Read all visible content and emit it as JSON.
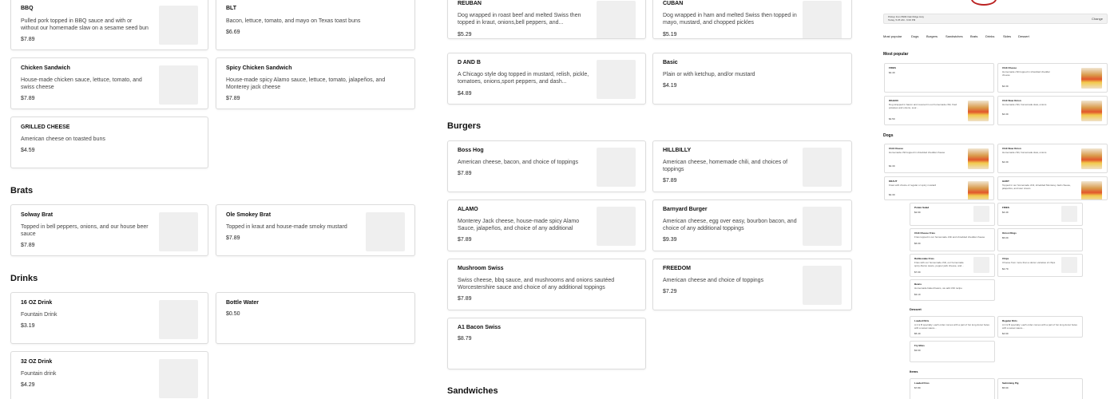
{
  "left": {
    "cards_top": [
      {
        "title": "BBQ",
        "desc": "Pulled pork topped in BBQ sauce and with or without our homemade slaw on a sesame seed bun",
        "price": "$7.89"
      },
      {
        "title": "BLT",
        "desc": "Bacon, lettuce, tomato, and mayo on Texas toast buns",
        "price": "$6.69"
      },
      {
        "title": "Chicken Sandwich",
        "desc": "House-made chicken sauce, lettuce, tomato, and swiss cheese",
        "price": "$7.89"
      },
      {
        "title": "Spicy Chicken Sandwich",
        "desc": "House-made spicy Alamo sauce, lettuce, tomato, jalapeños, and Monterey jack cheese",
        "price": "$7.89"
      },
      {
        "title": "GRILLED CHEESE",
        "desc": "American cheese on toasted buns",
        "price": "$4.59"
      }
    ],
    "brats_heading": "Brats",
    "brats": [
      {
        "title": "Solway Brat",
        "desc": "Topped in bell peppers, onions, and our house beer sauce",
        "price": "$7.89"
      },
      {
        "title": "Ole Smokey Brat",
        "desc": "Topped in kraut and house-made smoky mustard",
        "price": "$7.89"
      }
    ],
    "drinks_heading": "Drinks",
    "drinks": [
      {
        "title": "16 OZ Drink",
        "desc": "Fountain Drink",
        "price": "$3.19"
      },
      {
        "title": "Bottle Water",
        "desc": "",
        "price": "$0.50"
      },
      {
        "title": "32 OZ Drink",
        "desc": "Fountain drink",
        "price": "$4.29"
      }
    ]
  },
  "mid": {
    "cards_top": [
      {
        "title": "REUBAN",
        "desc": "Dog wrapped in roast beef and melted Swiss then topped in kraut, onions,bell peppers, and...",
        "price": "$5.29"
      },
      {
        "title": "CUBAN",
        "desc": "Dog wrapped in ham and melted Swiss then topped in mayo, mustard, and chopped pickles",
        "price": "$5.19"
      },
      {
        "title": "D AND B",
        "desc": "A Chicago style dog topped in mustard, relish, pickle, tomatoes, onions,sport peppers, and dash...",
        "price": "$4.89"
      },
      {
        "title": "Basic",
        "desc": "Plain or with ketchup, and/or mustard",
        "price": "$4.19"
      }
    ],
    "burgers_heading": "Burgers",
    "burgers": [
      {
        "title": "Boss Hog",
        "desc": "American cheese, bacon, and choice of toppings",
        "price": "$7.89"
      },
      {
        "title": "HILLBILLY",
        "desc": "American cheese, homemade chili, and choices of toppings",
        "price": "$7.89"
      },
      {
        "title": "ALAMO",
        "desc": "Monterey Jack cheese, house-made spicy Alamo Sauce, jalapeños, and choice of any additional toppings",
        "price": "$7.89"
      },
      {
        "title": "Barnyard Burger",
        "desc": "American cheese, egg over easy, bourbon bacon, and choice of any additional toppings",
        "price": "$9.39"
      },
      {
        "title": "Mushroom Swiss",
        "desc": "Swiss cheese, bbq sauce, and mushrooms and onions sautéed Worcestershire sauce and choice of any additional toppings",
        "price": "$7.89"
      },
      {
        "title": "FREEDOM",
        "desc": "American cheese and choice of toppings",
        "price": "$7.29"
      },
      {
        "title": "A1 Bacon Swiss",
        "desc": "",
        "price": "$8.79"
      }
    ],
    "sandwiches_heading": "Sandwiches"
  },
  "right": {
    "pickup_line1": "Pickup from 8909 Oak Ridge Hwy",
    "pickup_line2": "Today, 5:25 AM - 6:00 PM",
    "change_label": "Change",
    "tabs": [
      "Most popular",
      "Dogs",
      "Burgers",
      "Sandwiches",
      "Brats",
      "Drinks",
      "Sides",
      "Dessert"
    ],
    "most_popular_heading": "Most popular",
    "popular": [
      {
        "title": "FRIES",
        "desc": "",
        "price": "$4.49"
      },
      {
        "title": "Chili Cheese",
        "desc": "Homemade chili topped in shredded cheddar cheese",
        "price": "$4.39"
      },
      {
        "title": "WAGON",
        "desc": "Dog wrapped in bacon and covered in our homemade chili, fried potatoes and onions, sour...",
        "price": "$4.59"
      },
      {
        "title": "Chili Slaw Onion",
        "desc": "Homemade chili, homemade slaw, onions",
        "price": "$4.39"
      }
    ],
    "dogs_heading": "Dogs",
    "dogs": [
      {
        "title": "Chili Cheese",
        "desc": "Homemade chili topped in shredded cheddar cheese",
        "price": "$4.39"
      },
      {
        "title": "Chili Slaw Onion",
        "desc": "Homemade chili, homemade slaw, onions",
        "price": "$4.39"
      },
      {
        "title": "KRAUT",
        "desc": "Kraut with choice of regular or spicy mustard",
        "price": "$4.39"
      },
      {
        "title": "HAWT",
        "desc": "Topped in our homemade chili, shredded Monterey Jack cheese, jalapeños, and sour cream",
        "price": ""
      }
    ],
    "sides": [
      {
        "title": "Potato Salad",
        "desc": "",
        "price": "$2.99"
      },
      {
        "title": "FRIES",
        "desc": "",
        "price": "$4.49"
      },
      {
        "title": "Chili Cheese Fries",
        "desc": "Fries topped in our homemade chili and shredded cheddar cheese",
        "price": "$6.09"
      },
      {
        "title": "Onion Rings",
        "desc": "",
        "price": "$5.09"
      },
      {
        "title": "Rattlesnake Fries",
        "desc": "Fries with our homemade chili, our homemade spicy Alamo sauce, pepper jack cheese, and...",
        "price": "$7.09"
      },
      {
        "title": "Chips",
        "desc": "Choose from more than a dozen varieties of chips",
        "price": "$2.79"
      },
      {
        "title": "Beans",
        "desc": "Homemade baked beans, we add chili recipe",
        "price": "$3.19"
      }
    ],
    "dessert_heading": "Dessert",
    "dessert": [
      {
        "title": "Loaded Dirts",
        "desc": "A 2 & B specialty: each order comes with a pair of fun long donut holes with a sweet sauce...",
        "price": "$5.49"
      },
      {
        "title": "Regular Dirts",
        "desc": "A 2 & B specialty: each order comes with a pair of fun long donut holes with a sweet sauce...",
        "price": "$4.99"
      },
      {
        "title": "Fry Bites",
        "desc": "",
        "price": "$3.69"
      }
    ],
    "items_heading": "Items",
    "items": [
      {
        "title": "Loaded Fries",
        "desc": "",
        "price": "$7.89"
      },
      {
        "title": "Swimming Pig",
        "desc": "",
        "price": "$5.99"
      }
    ]
  }
}
